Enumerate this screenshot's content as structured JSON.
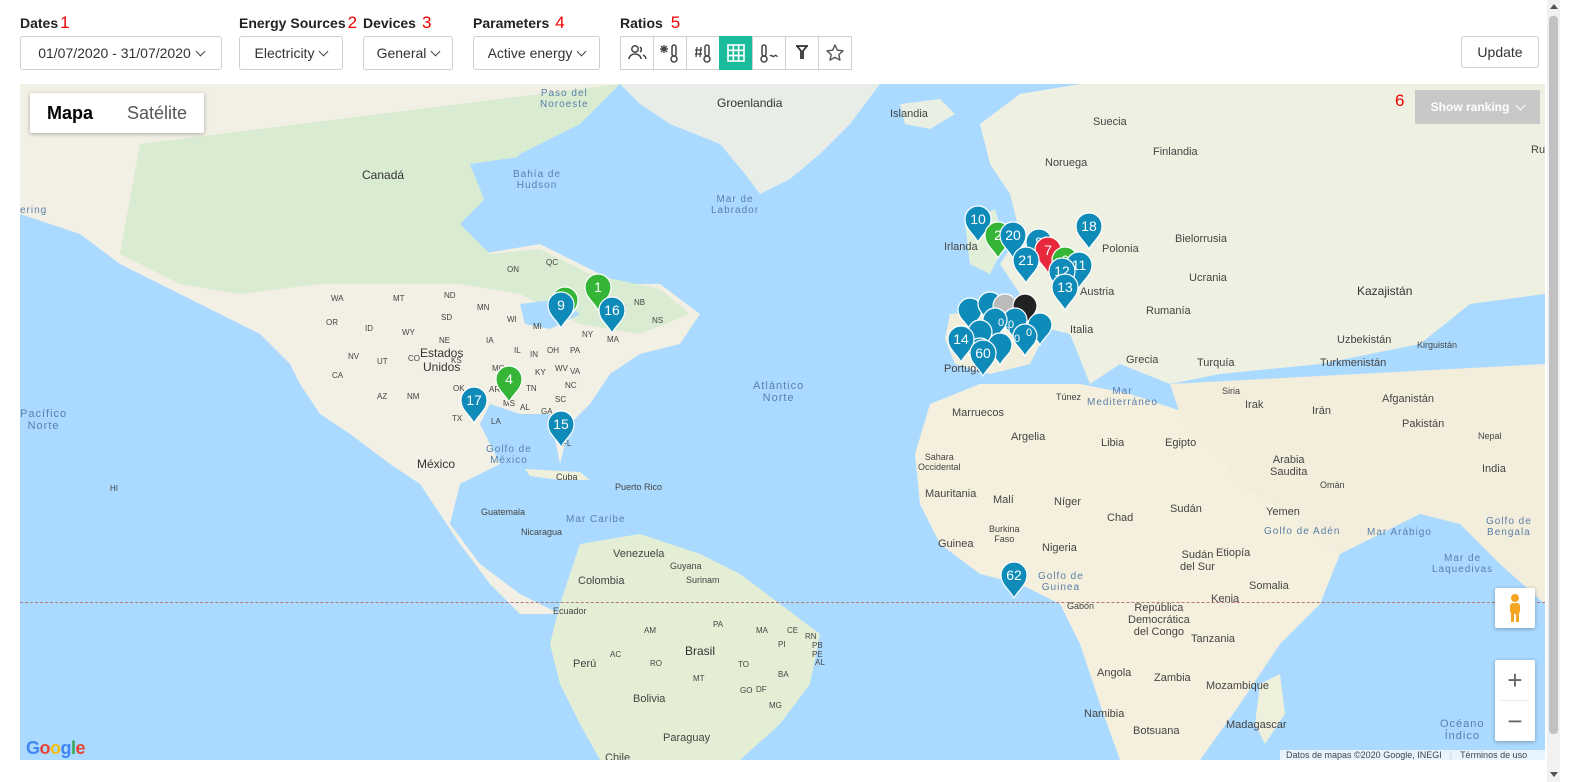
{
  "filters": {
    "dates": {
      "label": "Dates",
      "num": "1",
      "value": "01/07/2020 - 31/07/2020"
    },
    "energy": {
      "label": "Energy Sources",
      "num": "2",
      "value": "Electricity"
    },
    "devices": {
      "label": "Devices",
      "num": "3",
      "value": "General"
    },
    "parameters": {
      "label": "Parameters",
      "num": "4",
      "value": "Active energy"
    },
    "ratios": {
      "label": "Ratios",
      "num": "5",
      "icons": [
        "users-icon",
        "snow-thermometer-icon",
        "thermometer-hash-icon",
        "grid-icon",
        "thermometer-wave-icon",
        "filter-icon",
        "star-icon"
      ],
      "active_index": 3
    }
  },
  "update_label": "Update",
  "map": {
    "type_map": "Mapa",
    "type_satellite": "Satélite",
    "ranking_label": "Show ranking",
    "ranking_num": "6",
    "zoom_in": "+",
    "zoom_out": "−",
    "google": "Google",
    "attribution": "Datos de mapas ©2020 Google, INEGI",
    "terms": "Términos de uso",
    "colors": {
      "water": "#aadaff",
      "land": "#f5f1e5",
      "green": "#cde8c2",
      "marker_blue": "#0e8bb8",
      "marker_green": "#34b535",
      "marker_red": "#e8283c"
    },
    "labels": {
      "groenlandia": "Groenlandia",
      "islandia": "Islandia",
      "suecia": "Suecia",
      "finlandia": "Finlandia",
      "noruega": "Noruega",
      "irlanda": "Irlanda",
      "polonia": "Polonia",
      "bielorrusia": "Bielorrusia",
      "ucrania": "Ucrania",
      "kazajistan": "Kazajistán",
      "rumania": "Rumanía",
      "austria": "Austria",
      "italia": "Italia",
      "grecia": "Grecia",
      "turquia": "Turquía",
      "uzbekistan": "Uzbekistán",
      "kirguistan": "Kirguistán",
      "turkmenistan": "Turkmenistán",
      "siria": "Siria",
      "irak": "Irak",
      "iran": "Irán",
      "afganistan": "Afganistán",
      "pakistan": "Pakistán",
      "nepal": "Nepal",
      "india": "India",
      "portugal": "Portugal",
      "marruecos": "Marruecos",
      "tunez": "Túnez",
      "argelia": "Argelia",
      "libia": "Libia",
      "egipto": "Egipto",
      "arabia": "Arabia\nSaudita",
      "oman": "Omán",
      "yemen": "Yemen",
      "sahara": "Sahara\nOccidental",
      "mauritania": "Mauritania",
      "mali": "Malí",
      "niger": "Níger",
      "chad": "Chad",
      "sudan": "Sudán",
      "burkina": "Burkina\nFaso",
      "guinea": "Guinea",
      "nigeria": "Nigeria",
      "sursudan": "Sudán\ndel Sur",
      "etiopia": "Etiopía",
      "somalia": "Somalia",
      "gabon": "Gabón",
      "rdc": "República\nDemocrática\ndel Congo",
      "kenia": "Kenia",
      "tanzania": "Tanzania",
      "angola": "Angola",
      "zambia": "Zambia",
      "mozambique": "Mozambique",
      "namibia": "Namibia",
      "botsuana": "Botsuana",
      "madagascar": "Madagascar",
      "canada": "Canadá",
      "eeuu": "Estados\nUnidos",
      "mexico": "México",
      "cuba": "Cuba",
      "puertorico": "Puerto Rico",
      "guatemala": "Guatemala",
      "nicaragua": "Nicaragua",
      "venezuela": "Venezuela",
      "colombia": "Colombia",
      "guyana": "Guyana",
      "surinam": "Surinam",
      "ecuador": "Ecuador",
      "peru": "Perú",
      "brasil": "Brasil",
      "bolivia": "Bolivia",
      "paraguay": "Paraguay",
      "chile": "Chile",
      "ru": "Ru",
      "pasonoroeste": "Paso del\nNoroeste",
      "hudson": "Bahía de\nHudson",
      "labrador": "Mar de\nLabrador",
      "atlantico": "Atlántico\nNorte",
      "pacifico": "Pacífico\nNorte",
      "golfomexico": "Golfo de\nMéxico",
      "caribe": "Mar Caribe",
      "mediterraneo": "Mar\nMediterráneo",
      "golfoguinea": "Golfo de\nGuinea",
      "golfoaden": "Golfo de Adén",
      "arabico": "Mar Arábigo",
      "bengala": "Golfo de\nBengala",
      "laquedivas": "Mar de\nLaquedivas",
      "indico": "Océano\nÍndico",
      "bering": "ering",
      "hi": "HI",
      "qc": "QC",
      "on": "ON",
      "nb": "NB",
      "ns": "NS",
      "me": "ME",
      "ny": "NY",
      "pa": "PA",
      "ma": "MA",
      "mi": "MI",
      "oh": "OH",
      "in": "IN",
      "il": "IL",
      "wi": "WI",
      "mn": "MN",
      "ia": "IA",
      "mo": "MO",
      "ky": "KY",
      "wv": "WV",
      "va": "VA",
      "nc": "NC",
      "sc": "SC",
      "tn": "TN",
      "ga": "GA",
      "al": "AL",
      "ms": "MS",
      "la": "LA",
      "ar": "AR",
      "ok": "OK",
      "ks": "KS",
      "ne": "NE",
      "sd": "SD",
      "nd": "ND",
      "mt": "MT",
      "wy": "WY",
      "co": "CO",
      "nm": "NM",
      "tx": "TX",
      "az": "AZ",
      "ut": "UT",
      "nv": "NV",
      "ca": "CA",
      "or": "OR",
      "wa": "WA",
      "id": "ID",
      "fl": "FL",
      "am": "AM",
      "pa2": "PA",
      "ma2": "MA",
      "ce": "CE",
      "rn": "RN",
      "pb": "PB",
      "pe": "PE",
      "al2": "AL",
      "to": "TO",
      "pi": "PI",
      "ba": "BA",
      "ac": "AC",
      "ro": "RO",
      "mt2": "MT",
      "go": "GO",
      "mg": "MG",
      "df": "DF"
    },
    "markers": [
      {
        "n": "10",
        "c": "blue"
      },
      {
        "n": "2",
        "c": "green"
      },
      {
        "n": "20",
        "c": "blue"
      },
      {
        "n": "8",
        "c": "blue"
      },
      {
        "n": "7",
        "c": "red"
      },
      {
        "n": "6",
        "c": "green"
      },
      {
        "n": "11",
        "c": "blue"
      },
      {
        "n": "12",
        "c": "blue"
      },
      {
        "n": "21",
        "c": "blue"
      },
      {
        "n": "18",
        "c": "blue"
      },
      {
        "n": "13",
        "c": "blue"
      },
      {
        "n": "1",
        "c": "green"
      },
      {
        "n": "3",
        "c": "green"
      },
      {
        "n": "9",
        "c": "blue"
      },
      {
        "n": "16",
        "c": "blue"
      },
      {
        "n": "4",
        "c": "green"
      },
      {
        "n": "17",
        "c": "blue"
      },
      {
        "n": "15",
        "c": "blue"
      },
      {
        "n": "14",
        "c": "blue"
      },
      {
        "n": "60",
        "c": "blue"
      },
      {
        "n": "62",
        "c": "blue"
      }
    ]
  }
}
